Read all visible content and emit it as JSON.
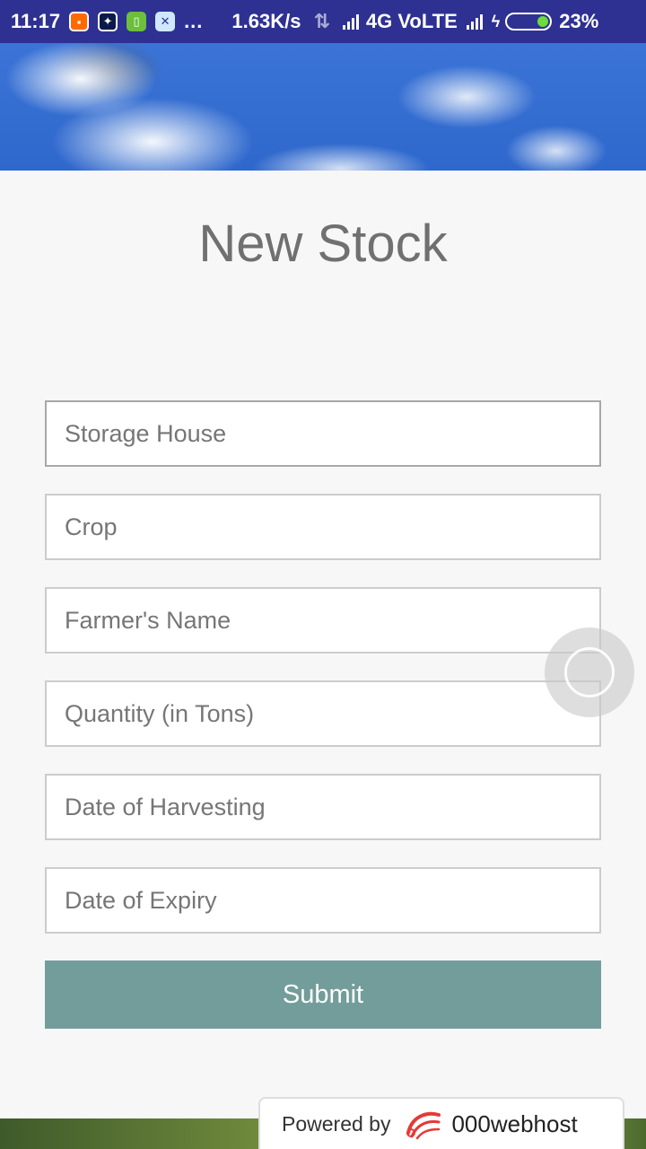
{
  "status_bar": {
    "time": "11:17",
    "overflow": "...",
    "net_speed": "1.63K/s",
    "network": "4G VoLTE",
    "battery": "23%"
  },
  "page": {
    "title": "New Stock"
  },
  "form": {
    "fields": [
      {
        "name": "storage-house",
        "placeholder": "Storage House"
      },
      {
        "name": "crop",
        "placeholder": "Crop"
      },
      {
        "name": "farmers-name",
        "placeholder": "Farmer's Name"
      },
      {
        "name": "quantity",
        "placeholder": "Quantity (in Tons)"
      },
      {
        "name": "date-of-harvesting",
        "placeholder": "Date of Harvesting"
      },
      {
        "name": "date-of-expiry",
        "placeholder": "Date of Expiry"
      }
    ],
    "submit_label": "Submit"
  },
  "footer": {
    "powered_by": "Powered by",
    "brand": "000webhost"
  },
  "colors": {
    "status_bar": "#2e3192",
    "submit_button": "#739d9a",
    "background": "#f7f7f7"
  }
}
